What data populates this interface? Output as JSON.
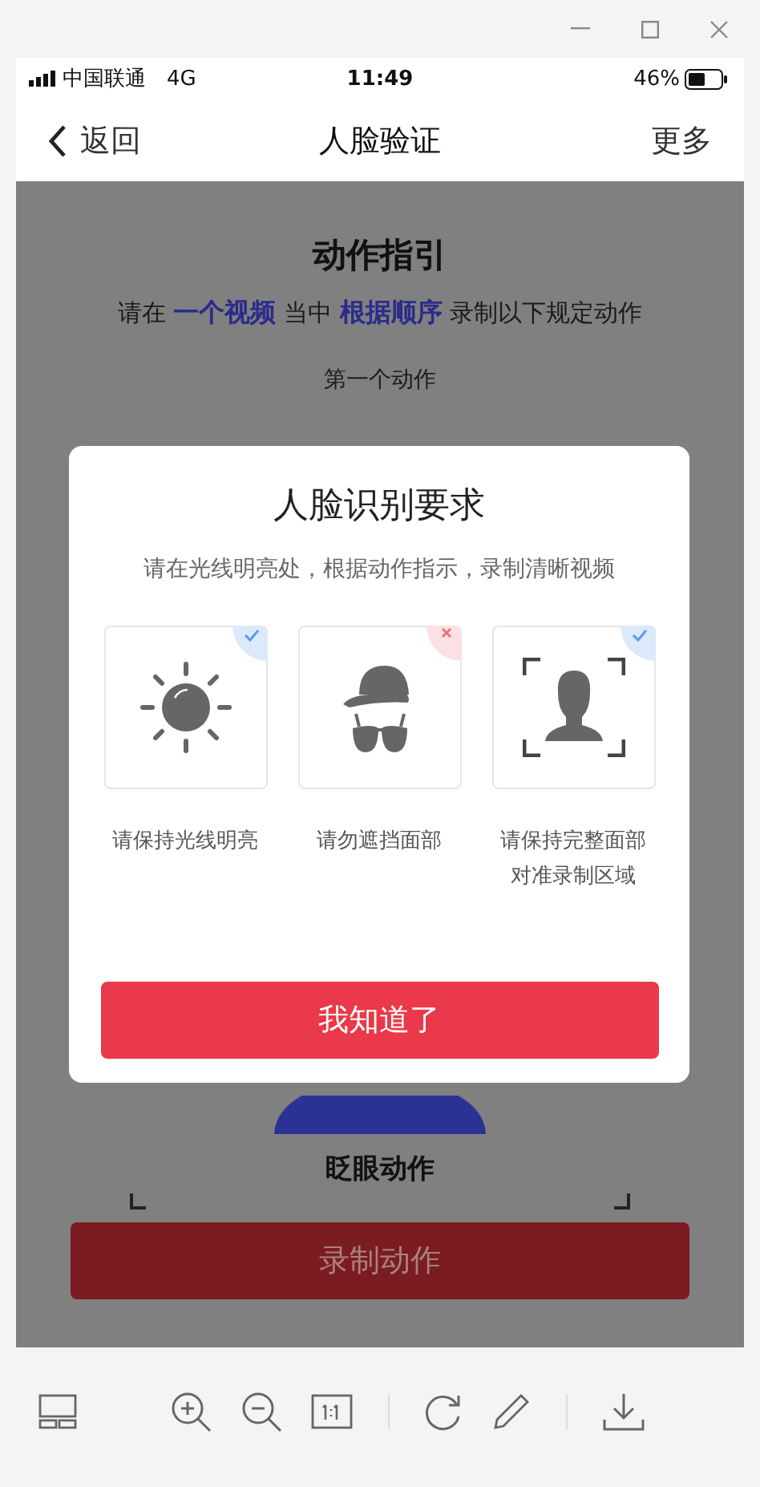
{
  "status_bar": {
    "carrier": "中国联通",
    "network": "4G",
    "time": "11:49",
    "battery": "46%"
  },
  "nav": {
    "back": "返回",
    "title": "人脸验证",
    "more": "更多"
  },
  "guide": {
    "title": "动作指引",
    "instruction": "请在 **一个视频** 当中 **根据顺序** 录制以下规定动作",
    "step": "第一个动作",
    "action": "眨眼动作",
    "record_button": "录制动作"
  },
  "dialog": {
    "title": "人脸识别要求",
    "subtitle": "请在光线明亮处，根据动作指示，录制清晰视频",
    "requirements": [
      {
        "label": "请保持光线明亮",
        "allowed": true
      },
      {
        "label": "请勿遮挡面部",
        "allowed": false
      },
      {
        "label": "请保持完整面部对准录制区域",
        "allowed": true
      }
    ],
    "button": "我知道了"
  }
}
